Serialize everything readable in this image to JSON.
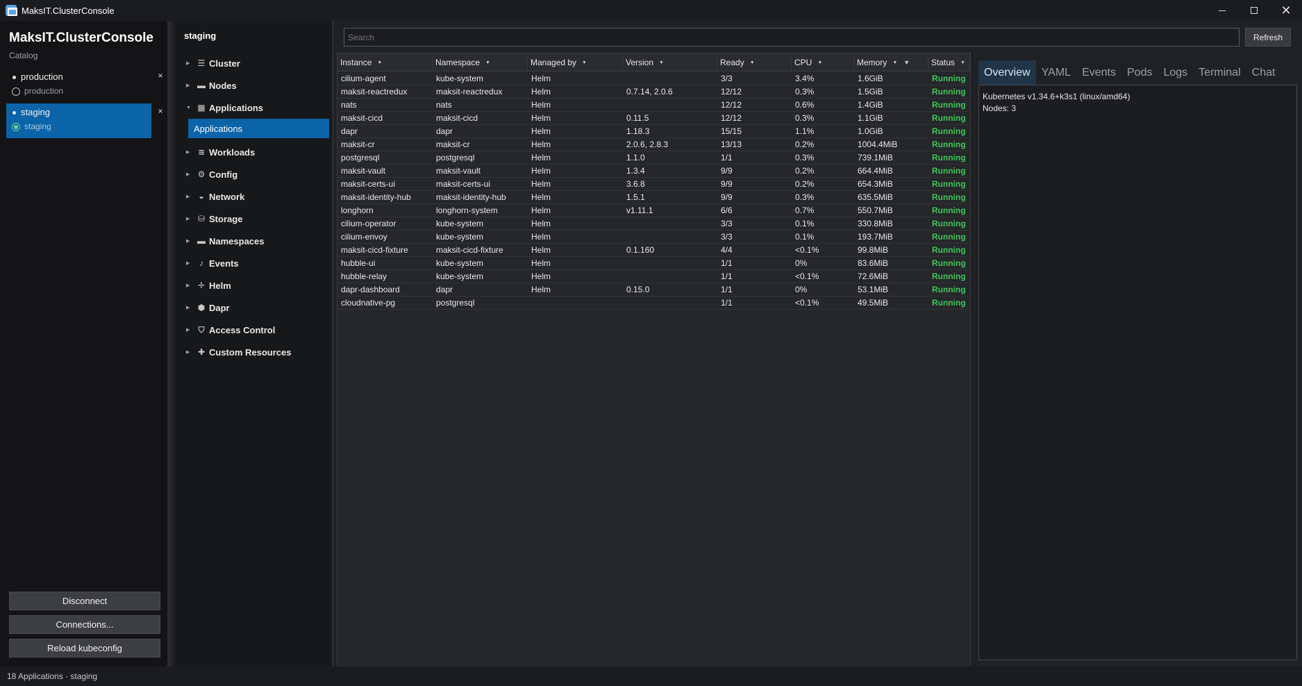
{
  "window": {
    "title": "MaksIT.ClusterConsole"
  },
  "sidebar": {
    "brand": "MaksIT.ClusterConsole",
    "subtitle": "Catalog",
    "connections": [
      {
        "name": "production",
        "context": "production",
        "active": false
      },
      {
        "name": "staging",
        "context": "staging",
        "active": true
      }
    ],
    "close_glyph": "×",
    "buttons": {
      "disconnect": "Disconnect",
      "connections": "Connections...",
      "reload": "Reload kubeconfig"
    }
  },
  "nav": {
    "title": "staging",
    "items": [
      {
        "label": "Cluster",
        "icon": "server-stack-icon"
      },
      {
        "label": "Nodes",
        "icon": "monitor-icon"
      },
      {
        "label": "Applications",
        "icon": "grid-icon"
      },
      {
        "label": "Workloads",
        "icon": "layers-icon"
      },
      {
        "label": "Config",
        "icon": "gear-icon"
      },
      {
        "label": "Network",
        "icon": "network-icon"
      },
      {
        "label": "Storage",
        "icon": "database-icon"
      },
      {
        "label": "Namespaces",
        "icon": "folder-icon"
      },
      {
        "label": "Events",
        "icon": "bell-icon"
      },
      {
        "label": "Helm",
        "icon": "helm-icon"
      },
      {
        "label": "Dapr",
        "icon": "hexagon-icon"
      },
      {
        "label": "Access Control",
        "icon": "shield-icon"
      },
      {
        "label": "Custom Resources",
        "icon": "puzzle-icon"
      }
    ],
    "selected_sub": "Applications"
  },
  "toolbar": {
    "search_placeholder": "Search",
    "refresh": "Refresh"
  },
  "table": {
    "columns": [
      "Instance",
      "Namespace",
      "Managed by",
      "Version",
      "Ready",
      "CPU",
      "Memory",
      "Status"
    ],
    "rows": [
      [
        "cilium-agent",
        "kube-system",
        "Helm",
        "",
        "3/3",
        "3.4%",
        "1.6GiB",
        "Running"
      ],
      [
        "maksit-reactredux",
        "maksit-reactredux",
        "Helm",
        "0.7.14, 2.0.6",
        "12/12",
        "0.3%",
        "1.5GiB",
        "Running"
      ],
      [
        "nats",
        "nats",
        "Helm",
        "",
        "12/12",
        "0.6%",
        "1.4GiB",
        "Running"
      ],
      [
        "maksit-cicd",
        "maksit-cicd",
        "Helm",
        "0.11.5",
        "12/12",
        "0.3%",
        "1.1GiB",
        "Running"
      ],
      [
        "dapr",
        "dapr",
        "Helm",
        "1.18.3",
        "15/15",
        "1.1%",
        "1.0GiB",
        "Running"
      ],
      [
        "maksit-cr",
        "maksit-cr",
        "Helm",
        "2.0.6, 2.8.3",
        "13/13",
        "0.2%",
        "1004.4MiB",
        "Running"
      ],
      [
        "postgresql",
        "postgresql",
        "Helm",
        "1.1.0",
        "1/1",
        "0.3%",
        "739.1MiB",
        "Running"
      ],
      [
        "maksit-vault",
        "maksit-vault",
        "Helm",
        "1.3.4",
        "9/9",
        "0.2%",
        "664.4MiB",
        "Running"
      ],
      [
        "maksit-certs-ui",
        "maksit-certs-ui",
        "Helm",
        "3.6.8",
        "9/9",
        "0.2%",
        "654.3MiB",
        "Running"
      ],
      [
        "maksit-identity-hub",
        "maksit-identity-hub",
        "Helm",
        "1.5.1",
        "9/9",
        "0.3%",
        "635.5MiB",
        "Running"
      ],
      [
        "longhorn",
        "longhorn-system",
        "Helm",
        "v1.11.1",
        "6/6",
        "0.7%",
        "550.7MiB",
        "Running"
      ],
      [
        "cilium-operator",
        "kube-system",
        "Helm",
        "",
        "3/3",
        "0.1%",
        "330.8MiB",
        "Running"
      ],
      [
        "cilium-envoy",
        "kube-system",
        "Helm",
        "",
        "3/3",
        "0.1%",
        "193.7MiB",
        "Running"
      ],
      [
        "maksit-cicd-fixture",
        "maksit-cicd-fixture",
        "Helm",
        "0.1.160",
        "4/4",
        "<0.1%",
        "99.8MiB",
        "Running"
      ],
      [
        "hubble-ui",
        "kube-system",
        "Helm",
        "",
        "1/1",
        "0%",
        "83.6MiB",
        "Running"
      ],
      [
        "hubble-relay",
        "kube-system",
        "Helm",
        "",
        "1/1",
        "<0.1%",
        "72.6MiB",
        "Running"
      ],
      [
        "dapr-dashboard",
        "dapr",
        "Helm",
        "0.15.0",
        "1/1",
        "0%",
        "53.1MiB",
        "Running"
      ],
      [
        "cloudnative-pg",
        "postgresql",
        "",
        "",
        "1/1",
        "<0.1%",
        "49.5MiB",
        "Running"
      ]
    ],
    "sorted_column": "Memory",
    "status_color": "#3fc45a"
  },
  "detail": {
    "tabs": [
      "Overview",
      "YAML",
      "Events",
      "Pods",
      "Logs",
      "Terminal",
      "Chat"
    ],
    "active_tab": "Overview",
    "lines": [
      "Kubernetes v1.34.6+k3s1 (linux/amd64)",
      "Nodes: 3"
    ]
  },
  "statusbar": {
    "text": "18 Applications · staging"
  },
  "colors": {
    "accent": "#0b63a8",
    "background": "#202124",
    "running": "#3fc45a"
  }
}
